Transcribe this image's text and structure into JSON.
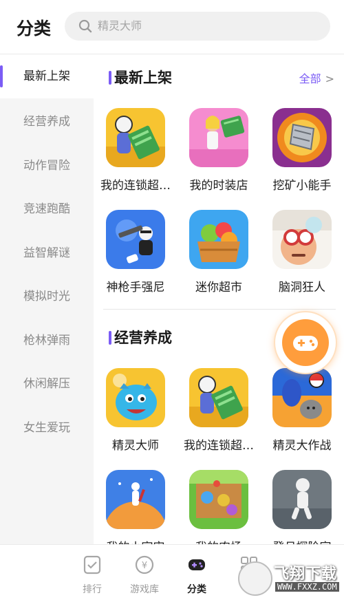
{
  "header": {
    "title": "分类",
    "search_placeholder": "精灵大师"
  },
  "sidebar": {
    "items": [
      {
        "label": "最新上架",
        "active": true
      },
      {
        "label": "经营养成",
        "active": false
      },
      {
        "label": "动作冒险",
        "active": false
      },
      {
        "label": "竞速跑酷",
        "active": false
      },
      {
        "label": "益智解谜",
        "active": false
      },
      {
        "label": "模拟时光",
        "active": false
      },
      {
        "label": "枪林弹雨",
        "active": false
      },
      {
        "label": "休闲解压",
        "active": false
      },
      {
        "label": "女生爱玩",
        "active": false
      }
    ]
  },
  "main": {
    "sections": [
      {
        "title": "最新上架",
        "more": "全部",
        "apps": [
          {
            "name": "我的连锁超…",
            "icon": "chain-supermarket-icon"
          },
          {
            "name": "我的时装店",
            "icon": "fashion-store-icon"
          },
          {
            "name": "挖矿小能手",
            "icon": "mining-drill-icon"
          },
          {
            "name": "神枪手强尼",
            "icon": "gunner-johnny-icon"
          },
          {
            "name": "迷你超市",
            "icon": "fruit-basket-icon"
          },
          {
            "name": "脑洞狂人",
            "icon": "brain-puzzle-icon"
          }
        ]
      },
      {
        "title": "经营养成",
        "apps": [
          {
            "name": "精灵大师",
            "icon": "blue-dragon-icon"
          },
          {
            "name": "我的连锁超…",
            "icon": "chain-supermarket-icon"
          },
          {
            "name": "精灵大作战",
            "icon": "pokeball-battle-icon"
          },
          {
            "name": "我的小宇宙",
            "icon": "tiny-planet-icon"
          },
          {
            "name": "我的农场",
            "icon": "farm-icon"
          },
          {
            "name": "登月探险家",
            "icon": "moon-explorer-icon"
          }
        ]
      }
    ]
  },
  "tabbar": {
    "items": [
      {
        "label": "排行",
        "icon": "ranking-icon",
        "active": false
      },
      {
        "label": "游戏库",
        "icon": "game-library-icon",
        "active": false
      },
      {
        "label": "分类",
        "icon": "gamepad-icon",
        "active": true
      },
      {
        "label": "",
        "icon": "grid-icon",
        "active": false
      }
    ]
  },
  "watermark": {
    "brand": "飞翔下载",
    "url": "WWW.FXXZ.COM"
  },
  "colors": {
    "accent": "#7b5cf5",
    "fab": "#ff9d3c"
  }
}
